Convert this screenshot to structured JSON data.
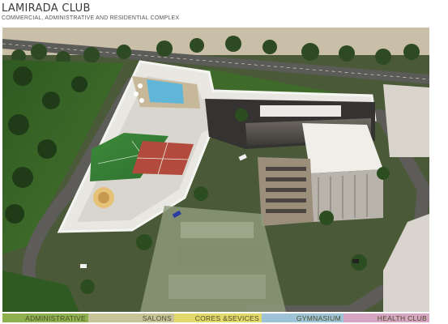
{
  "header": {
    "title": "LAMIRADA CLUB",
    "subtitle": "COMMERCIAL, ADMINISTRATIVE AND RESIDENTIAL COMPLEX"
  },
  "legend": {
    "items": [
      {
        "label": "ADMINISTRATIVE",
        "color": "#8fb04f"
      },
      {
        "label": "SALONS",
        "color": "#c8c49a"
      },
      {
        "label": "CORES &SEVICES",
        "color": "#e3d96a"
      },
      {
        "label": "GYMNASIUM",
        "color": "#9fc3d6"
      },
      {
        "label": "HEALTH CLUB",
        "color": "#d6a6c3"
      }
    ]
  }
}
